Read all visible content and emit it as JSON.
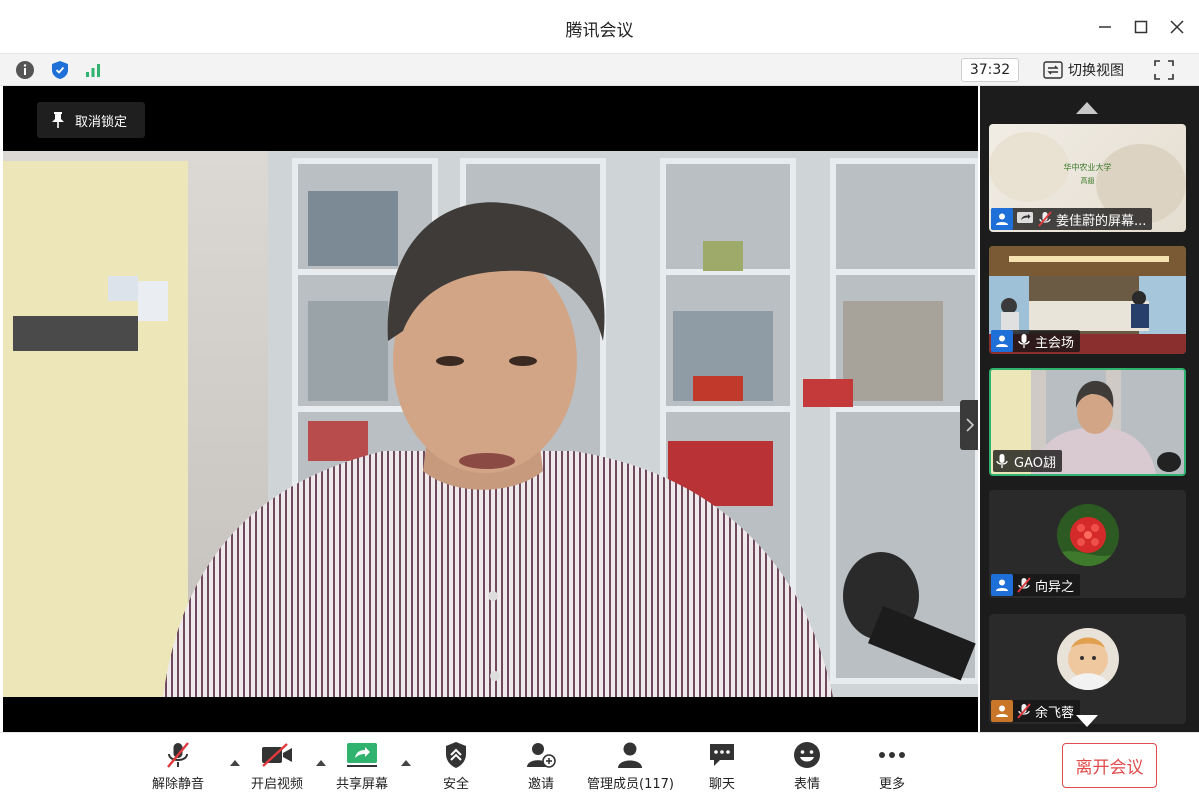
{
  "window": {
    "title": "腾讯会议"
  },
  "infobar": {
    "timer": "37:32",
    "switch_view_label": "切换视图"
  },
  "main_video": {
    "unpin_label": "取消锁定"
  },
  "sidebar": {
    "tiles": [
      {
        "name": "姜佳蔚的屏幕...",
        "slide_title": "华中农业大学",
        "slide_sub": "高翅"
      },
      {
        "name": "主会场"
      },
      {
        "name": "GAO翃"
      },
      {
        "name": "向异之"
      },
      {
        "name": "余飞蓉"
      }
    ]
  },
  "toolbar": {
    "unmute_label": "解除静音",
    "video_label": "开启视频",
    "share_label": "共享屏幕",
    "security_label": "安全",
    "invite_label": "邀请",
    "members_label": "管理成员(117)",
    "chat_label": "聊天",
    "reactions_label": "表情",
    "more_label": "更多",
    "leave_label": "离开会议"
  },
  "colors": {
    "accent_green": "#2fb36f",
    "leave_red": "#e24b4b",
    "user_blue": "#1f6fd8",
    "mute_red": "#e0393e"
  }
}
